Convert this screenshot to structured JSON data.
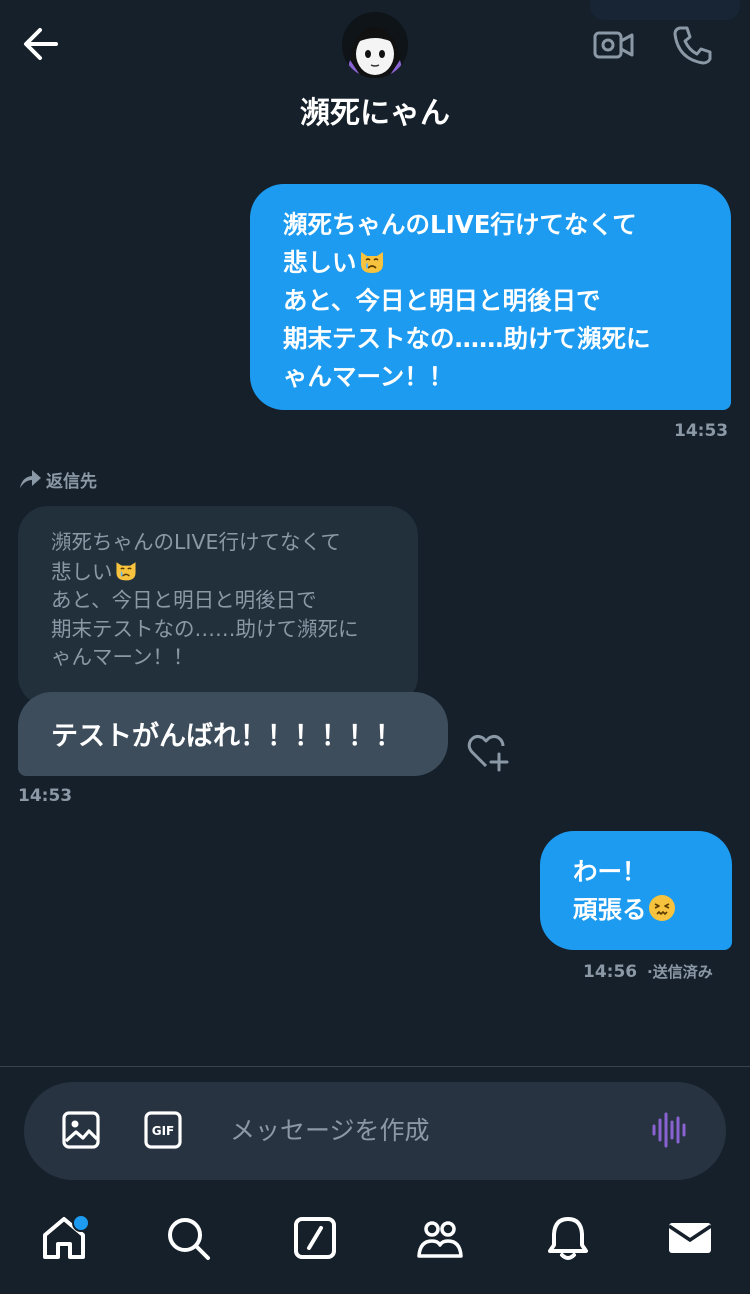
{
  "header": {
    "title": "瀕死にゃん",
    "back_icon": "arrow-left-icon",
    "video_icon": "video-call-icon",
    "phone_icon": "phone-icon"
  },
  "messages": {
    "outgoing_1": {
      "lines": [
        "瀕死ちゃんのLIVE行けてなくて",
        "悲しい",
        "あと、今日と明日と明後日で",
        "期末テストなの……助けて瀕死に",
        "ゃんマーン！！"
      ],
      "emoji": "crying-cat-emoji",
      "time": "14:53"
    },
    "reply": {
      "label": "返信先",
      "quoted_lines": [
        "瀕死ちゃんのLIVE行けてなくて",
        "悲しい",
        "あと、今日と明日と明後日で",
        "期末テストなの……助けて瀕死に",
        "ゃんマーン！！"
      ]
    },
    "incoming_1": {
      "text": "テストがんばれ！！！！！！",
      "time": "14:53"
    },
    "outgoing_2": {
      "lines": [
        "わー！",
        "頑張る"
      ],
      "emoji": "persevering-face-emoji",
      "time": "14:56",
      "status": "·送信済み"
    }
  },
  "composer": {
    "placeholder": "メッセージを作成",
    "image_icon": "image-icon",
    "gif_icon": "gif-icon",
    "voice_icon": "voice-wave-icon",
    "gif_label": "GIF"
  },
  "nav": {
    "items": [
      "home-icon",
      "search-icon",
      "grok-icon",
      "communities-icon",
      "notifications-icon",
      "messages-icon"
    ]
  },
  "colors": {
    "background": "#15202b",
    "accent": "#1d9bf0",
    "incoming": "#3d4d5c",
    "muted": "#8b98a5"
  }
}
